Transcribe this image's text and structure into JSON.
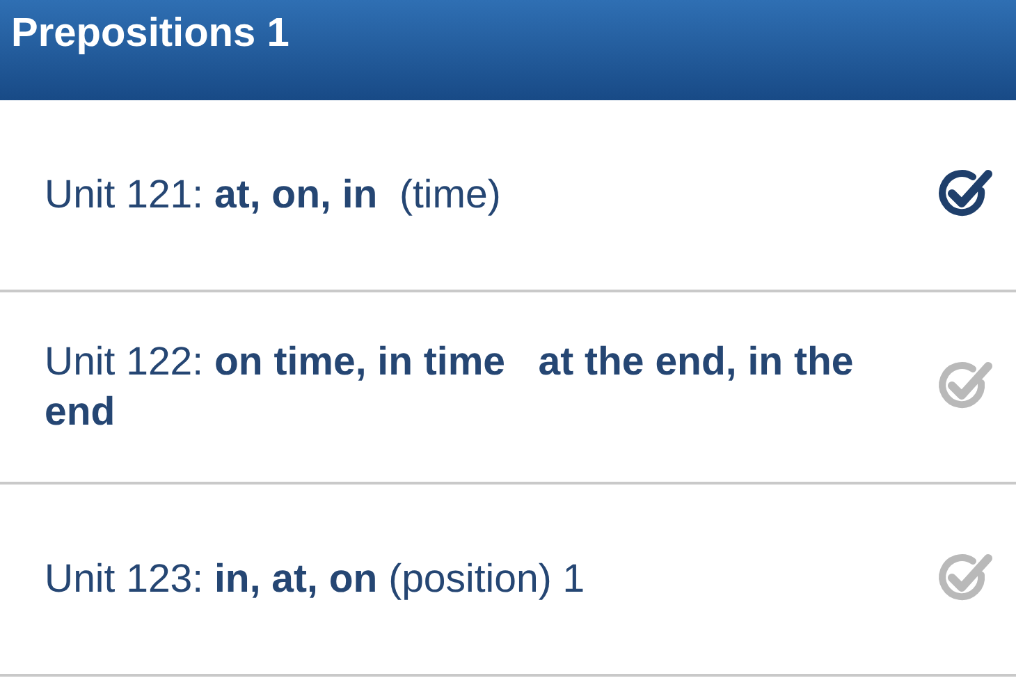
{
  "header": {
    "title": "Prepositions 1"
  },
  "units": [
    {
      "label": "Unit 121: **at, on, in**  (time)",
      "completed": true
    },
    {
      "label": "Unit 122: **on time, in time   at the end, in the end**",
      "completed": false
    },
    {
      "label": "Unit 123: **in, at, on** (position) 1",
      "completed": false
    }
  ]
}
